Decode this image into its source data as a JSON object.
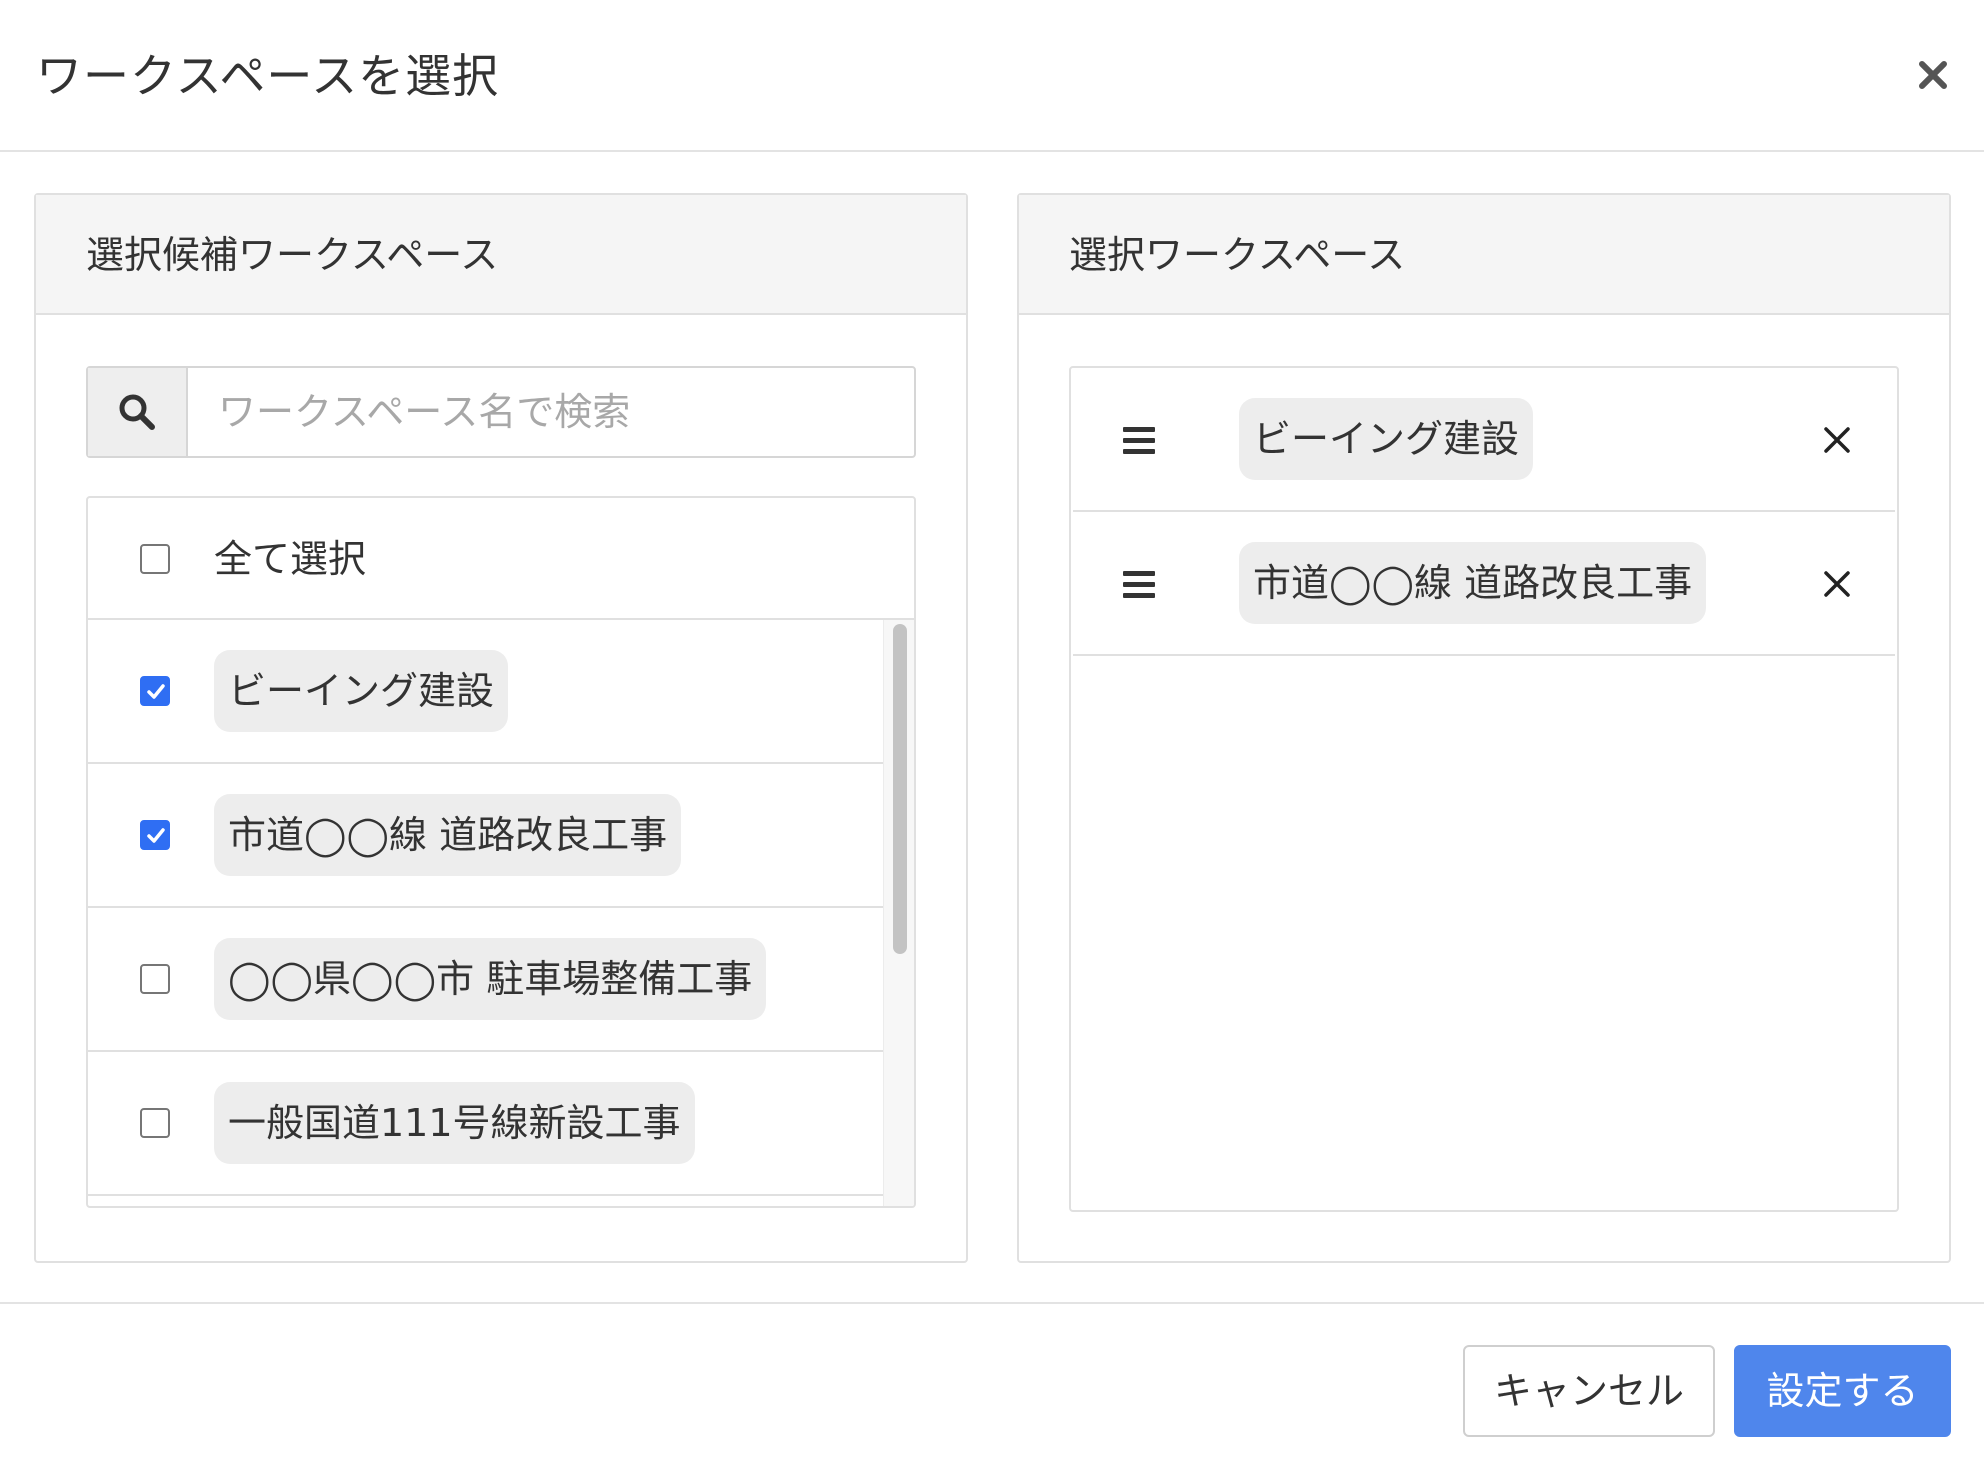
{
  "modal": {
    "title": "ワークスペースを選択"
  },
  "candidates": {
    "title": "選択候補ワークスペース",
    "search_placeholder": "ワークスペース名で検索",
    "select_all_label": "全て選択",
    "select_all_checked": false,
    "items": [
      {
        "label": "ビーイング建設",
        "checked": true
      },
      {
        "label": "市道◯◯線 道路改良工事",
        "checked": true
      },
      {
        "label": "◯◯県◯◯市 駐車場整備工事",
        "checked": false
      },
      {
        "label": "一般国道111号線新設工事",
        "checked": false
      }
    ]
  },
  "selected": {
    "title": "選択ワークスペース",
    "items": [
      {
        "label": "ビーイング建設"
      },
      {
        "label": "市道◯◯線 道路改良工事"
      }
    ]
  },
  "footer": {
    "cancel_label": "キャンセル",
    "submit_label": "設定する"
  },
  "colors": {
    "accent": "#4f86ec",
    "checkbox_checked": "#2f6ef3"
  },
  "icons": {
    "close": "close-icon",
    "search": "search-icon",
    "drag": "drag-handle-icon",
    "remove": "remove-icon",
    "check": "check-icon"
  }
}
